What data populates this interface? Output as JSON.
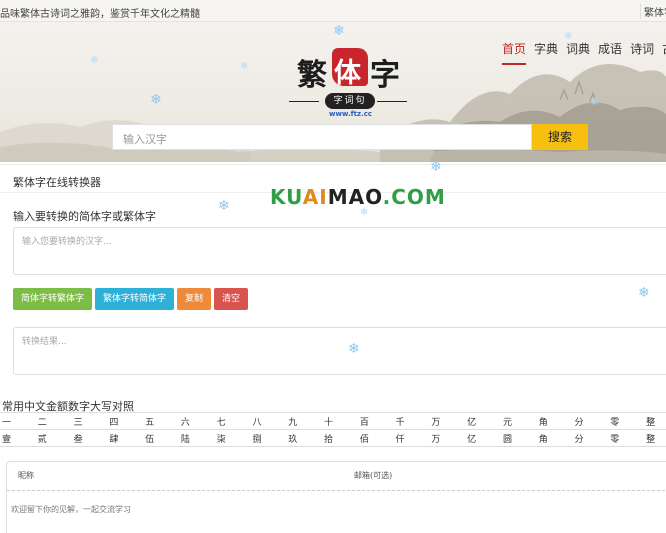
{
  "topbar": {
    "slogan": "品味繁体古诗词之雅韵，鉴赏千年文化之精髓",
    "right_link": "繁体字"
  },
  "logo": {
    "char1": "繁",
    "char2": "体",
    "char3": "字",
    "seal": "字词句",
    "domain": "www.ftz.cc"
  },
  "nav": {
    "items": [
      "首页",
      "字典",
      "词典",
      "成语",
      "诗词",
      "古"
    ]
  },
  "search": {
    "placeholder": "输入汉字",
    "button": "搜索"
  },
  "converter": {
    "title": "繁体字在线转换器",
    "watermark": "KUAIMAO.COM",
    "input_label": "输入要转换的简体字或繁体字",
    "input_placeholder": "输入您要转换的汉字...",
    "buttons": {
      "to_traditional": "简体字转繁体字",
      "to_simplified": "繁体字转简体字",
      "copy": "复制",
      "clear": "清空"
    },
    "output_placeholder": "转换结果..."
  },
  "money": {
    "title": "常用中文金额数字大写对照",
    "lower": [
      "一",
      "二",
      "三",
      "四",
      "五",
      "六",
      "七",
      "八",
      "九",
      "十",
      "百",
      "千",
      "万",
      "亿",
      "元",
      "角",
      "分",
      "零",
      "整"
    ],
    "upper": [
      "壹",
      "贰",
      "叁",
      "肆",
      "伍",
      "陆",
      "柒",
      "捌",
      "玖",
      "拾",
      "佰",
      "仟",
      "万",
      "亿",
      "圆",
      "角",
      "分",
      "零",
      "整"
    ]
  },
  "comment": {
    "nickname": "昵称",
    "email": "邮箱(可选)",
    "placeholder": "欢迎留下你的见解，一起交流学习"
  },
  "colors": {
    "accent_red": "#b92b27",
    "search_yellow": "#f7bf10",
    "btn_green": "#7cbd45",
    "btn_blue": "#2fb0d9",
    "btn_orange": "#ef8a3a",
    "btn_red": "#d9534f"
  }
}
